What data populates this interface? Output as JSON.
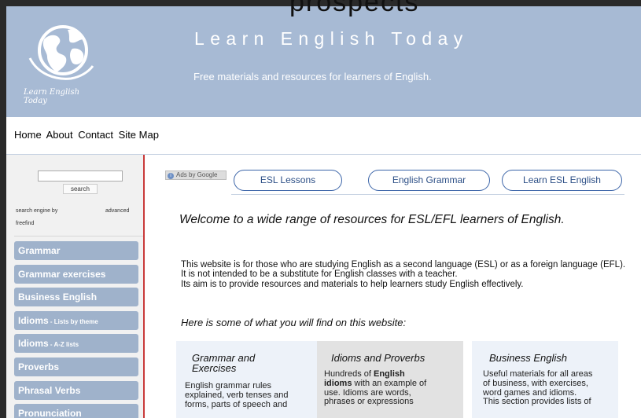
{
  "header": {
    "site_title": "Learn English Today",
    "site_subtitle": "Free materials and resources for learners of English.",
    "logo_text": "Learn English Today",
    "scroll_text": "prospects"
  },
  "nav": {
    "items": [
      "Home",
      "About",
      "Contact",
      "Site Map"
    ]
  },
  "sidebar": {
    "search_button": "search",
    "search_engine_label": "search engine by",
    "advanced_link": "advanced",
    "freefind_link": "freefind",
    "menu": [
      {
        "label": "Grammar",
        "sub": ""
      },
      {
        "label": "Grammar exercises",
        "sub": ""
      },
      {
        "label": "Business English",
        "sub": ""
      },
      {
        "label": "Idioms",
        "sub": " - Lists by theme"
      },
      {
        "label": "Idioms",
        "sub": " - A-Z lists"
      },
      {
        "label": "Proverbs",
        "sub": ""
      },
      {
        "label": "Phrasal Verbs",
        "sub": ""
      },
      {
        "label": "Pronunciation",
        "sub": ""
      }
    ]
  },
  "ads": {
    "badge_label": "Ads by Google",
    "links": [
      "ESL Lessons",
      "English Grammar",
      "Learn ESL English"
    ]
  },
  "main": {
    "welcome": "Welcome to a wide range of resources for ESL/EFL learners of English.",
    "intro_1": "This website is for those who are studying English as a second language (ESL) or as a foreign language (EFL).",
    "intro_2": "It is not intended to be a substitute for English classes with a teacher.",
    "intro_3": "Its aim is to provide resources and materials to help learners study English effectively.",
    "found_heading": "Here is some of what you will find on this website:"
  },
  "cards": {
    "grammar": {
      "title_line1": "Grammar and",
      "title_line2": "Exercises",
      "text_line1": "English grammar rules",
      "text_line2": "explained, verb tenses and",
      "text_line3": "forms, parts of speech and"
    },
    "idioms": {
      "title": "Idioms and Proverbs",
      "text_line1_pre": "Hundreds of ",
      "text_line1_bold": "English",
      "text_line2_bold": "idioms",
      "text_line2_post": " with an example of",
      "text_line3": "use. Idioms are words,",
      "text_line4": "phrases or expressions"
    },
    "business": {
      "title": "Business English",
      "text_line1": "Useful materials for all areas",
      "text_line2": "of business, with exercises,",
      "text_line3": "word games and idioms.",
      "text_line4": "This section provides lists of"
    }
  },
  "colors": {
    "header_bg": "#a7bad4",
    "menu_bg": "#9fb2cb",
    "sidebar_rule": "#c93a3a",
    "pill_border": "#3b64a8"
  }
}
